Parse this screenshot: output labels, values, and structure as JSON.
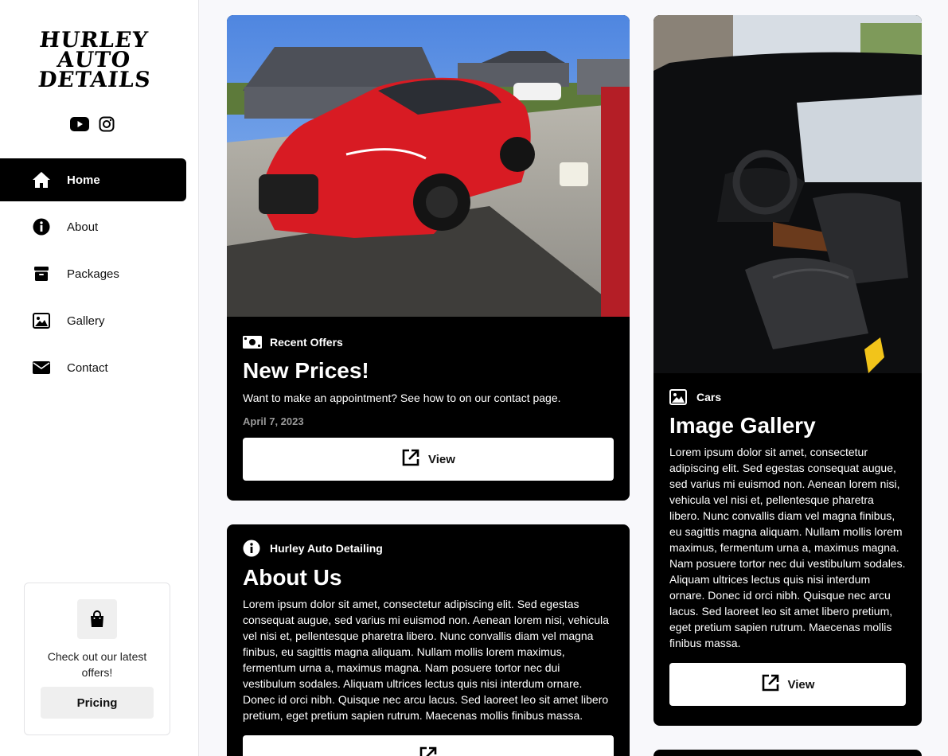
{
  "brand": {
    "logo_lines": [
      "HURLEY",
      "AUTO",
      "DETAILS"
    ]
  },
  "socials": [
    {
      "icon": "youtube-icon"
    },
    {
      "icon": "instagram-icon"
    }
  ],
  "nav": [
    {
      "label": "Home",
      "icon": "home-icon",
      "active": true
    },
    {
      "label": "About",
      "icon": "info-icon"
    },
    {
      "label": "Packages",
      "icon": "box-icon"
    },
    {
      "label": "Gallery",
      "icon": "image-icon"
    },
    {
      "label": "Contact",
      "icon": "envelope-icon"
    }
  ],
  "promo": {
    "text": "Check out our latest offers!",
    "button": "Pricing",
    "icon": "shopping-bag-icon"
  },
  "cards": {
    "offers": {
      "tag": "Recent Offers",
      "tag_icon": "money-bill-icon",
      "title": "New Prices!",
      "text": "Want to make an appointment? See how to on our contact page.",
      "date": "April 7, 2023",
      "button": "View",
      "image": "red sports car on wet driveway"
    },
    "gallery": {
      "tag": "Cars",
      "tag_icon": "image-icon",
      "title": "Image Gallery",
      "text": "Lorem ipsum dolor sit amet, consectetur adipiscing elit. Sed egestas consequat augue, sed varius mi euismod non. Aenean lorem nisi, vehicula vel nisi et, pellentesque pharetra libero. Nunc convallis diam vel magna finibus, eu sagittis magna aliquam. Nullam mollis lorem maximus, fermentum urna a, maximus magna. Nam posuere tortor nec dui vestibulum sodales. Aliquam ultrices lectus quis nisi interdum ornare. Donec id orci nibh. Quisque nec arcu lacus. Sed laoreet leo sit amet libero pretium, eget pretium sapien rutrum. Maecenas mollis finibus massa.",
      "button": "View",
      "image": "black car interior with leather seats"
    },
    "about": {
      "tag": "Hurley Auto Detailing",
      "tag_icon": "info-icon",
      "title": "About Us",
      "text": "Lorem ipsum dolor sit amet, consectetur adipiscing elit. Sed egestas consequat augue, sed varius mi euismod non. Aenean lorem nisi, vehicula vel nisi et, pellentesque pharetra libero. Nunc convallis diam vel magna finibus, eu sagittis magna aliquam. Nullam mollis lorem maximus, fermentum urna a, maximus magna. Nam posuere tortor nec dui vestibulum sodales. Aliquam ultrices lectus quis nisi interdum ornare. Donec id orci nibh. Quisque nec arcu lacus. Sed laoreet leo sit amet libero pretium, eget pretium sapien rutrum. Maecenas mollis finibus massa."
    }
  },
  "colors": {
    "accent": "#000000",
    "background": "#f8f8fb",
    "button_bg": "#efefef",
    "date": "#9a9a9a"
  }
}
